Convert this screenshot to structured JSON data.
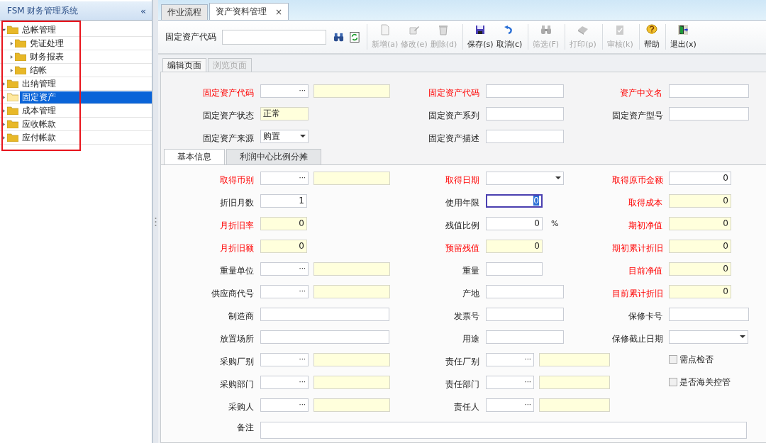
{
  "app": {
    "title": "FSM 财务管理系统",
    "collapse_glyph": "«"
  },
  "tree": [
    {
      "label": "总帐管理",
      "selected": false,
      "expanded": true,
      "children": [
        {
          "label": "凭证处理",
          "selected": false,
          "expanded": false
        },
        {
          "label": "财务报表",
          "selected": false,
          "expanded": false
        },
        {
          "label": "结帐",
          "selected": false,
          "expanded": false
        }
      ]
    },
    {
      "label": "出纳管理",
      "selected": false,
      "expanded": false
    },
    {
      "label": "固定资产",
      "selected": true,
      "expanded": false
    },
    {
      "label": "成本管理",
      "selected": false,
      "expanded": false
    },
    {
      "label": "应收帐款",
      "selected": false,
      "expanded": false
    },
    {
      "label": "应付帐款",
      "selected": false,
      "expanded": false
    }
  ],
  "tabs": [
    {
      "label": "作业流程",
      "selected": false
    },
    {
      "label": "资产资料管理",
      "selected": true,
      "close": "×"
    }
  ],
  "toolbar": {
    "search_label": "固定资产代码",
    "groups": [
      [
        {
          "label": "新增(a)",
          "kind": "new",
          "disabled": true
        },
        {
          "label": "修改(e)",
          "kind": "edit",
          "disabled": true
        },
        {
          "label": "删除(d)",
          "kind": "delete",
          "disabled": true
        }
      ],
      [
        {
          "label": "保存(s)",
          "kind": "save",
          "disabled": false
        },
        {
          "label": "取消(c)",
          "kind": "undo",
          "disabled": false
        }
      ],
      [
        {
          "label": "筛选(F)",
          "kind": "filter",
          "disabled": true
        }
      ],
      [
        {
          "label": "打印(p)",
          "kind": "print",
          "disabled": true
        }
      ],
      [
        {
          "label": "审核(k)",
          "kind": "audit",
          "disabled": true
        }
      ],
      [
        {
          "label": "帮助",
          "kind": "help",
          "disabled": false
        }
      ],
      [
        {
          "label": "退出(x)",
          "kind": "exit",
          "disabled": false
        }
      ]
    ]
  },
  "page_tabs": [
    {
      "label": "编辑页面",
      "selected": true
    },
    {
      "label": "浏览页面",
      "selected": false
    }
  ],
  "header_form": {
    "rows": [
      [
        {
          "label": "固定资产代码",
          "required": true,
          "kind": "lookup",
          "readonly": false,
          "button": "···"
        },
        {
          "label": "固定资产代码",
          "required": true,
          "kind": "text",
          "readonly": false
        },
        {
          "label": "资产中文名",
          "required": true,
          "kind": "text",
          "readonly": false
        }
      ],
      [
        {
          "label": "固定资产状态",
          "required": false,
          "kind": "short-text",
          "readonly": true,
          "value": "正常"
        },
        {
          "label": "固定资产系列",
          "required": false,
          "kind": "text",
          "readonly": false
        },
        {
          "label": "固定资产型号",
          "required": false,
          "kind": "text",
          "readonly": false
        }
      ],
      [
        {
          "label": "固定资产来源",
          "required": false,
          "kind": "select",
          "readonly": false,
          "value": "购置"
        },
        {
          "label": "固定资产描述",
          "required": false,
          "kind": "text",
          "readonly": false
        }
      ]
    ]
  },
  "detail_tabs": [
    {
      "label": "基本信息",
      "selected": true
    },
    {
      "label": "利润中心比例分摊",
      "selected": false
    }
  ],
  "detail_form": {
    "rows": [
      [
        {
          "label": "取得币别",
          "required": true,
          "kind": "lookup",
          "readonly": false,
          "button": "···"
        },
        {
          "label": "取得日期",
          "required": true,
          "kind": "select",
          "readonly": false
        },
        {
          "label": "取得原币金额",
          "required": true,
          "kind": "number",
          "readonly": false,
          "value": "0"
        }
      ],
      [
        {
          "label": "折旧月数",
          "required": false,
          "kind": "number",
          "readonly": false,
          "value": "1"
        },
        {
          "label": "使用年限",
          "required": false,
          "kind": "number",
          "readonly": false,
          "value": "0",
          "focused": true
        },
        {
          "label": "取得成本",
          "required": true,
          "kind": "number",
          "readonly": true,
          "value": "0"
        }
      ],
      [
        {
          "label": "月折旧率",
          "required": true,
          "kind": "number",
          "readonly": true,
          "value": "0"
        },
        {
          "label": "残值比例",
          "required": false,
          "kind": "number",
          "readonly": false,
          "value": "0",
          "suffix": "%"
        },
        {
          "label": "期初净值",
          "required": true,
          "kind": "number",
          "readonly": true,
          "value": "0"
        }
      ],
      [
        {
          "label": "月折旧额",
          "required": true,
          "kind": "number",
          "readonly": true,
          "value": "0"
        },
        {
          "label": "预留残值",
          "required": true,
          "kind": "number",
          "readonly": true,
          "value": "0"
        },
        {
          "label": "期初累计折旧",
          "required": true,
          "kind": "number",
          "readonly": true,
          "value": "0"
        }
      ],
      [
        {
          "label": "重量单位",
          "required": false,
          "kind": "lookup",
          "readonly": false,
          "button": "···"
        },
        {
          "label": "重量",
          "required": false,
          "kind": "short-text",
          "readonly": false
        },
        {
          "label": "目前净值",
          "required": true,
          "kind": "number",
          "readonly": true,
          "value": "0"
        }
      ],
      [
        {
          "label": "供应商代号",
          "required": false,
          "kind": "lookup",
          "readonly": false,
          "button": "···"
        },
        {
          "label": "产地",
          "required": false,
          "kind": "text",
          "readonly": false
        },
        {
          "label": "目前累计折旧",
          "required": true,
          "kind": "number",
          "readonly": true,
          "value": "0"
        }
      ],
      [
        {
          "label": "制造商",
          "required": false,
          "kind": "wide-text",
          "readonly": false
        },
        {
          "label": "发票号",
          "required": false,
          "kind": "text",
          "readonly": false
        },
        {
          "label": "保修卡号",
          "required": false,
          "kind": "text",
          "readonly": false
        }
      ],
      [
        {
          "label": "放置场所",
          "required": false,
          "kind": "wide-text",
          "readonly": false
        },
        {
          "label": "用途",
          "required": false,
          "kind": "text",
          "readonly": false
        },
        {
          "label": "保修截止日期",
          "required": false,
          "kind": "select",
          "readonly": false
        }
      ],
      [
        {
          "label": "采购厂别",
          "required": false,
          "kind": "lookup",
          "readonly": false,
          "button": "···"
        },
        {
          "label": "责任厂别",
          "required": false,
          "kind": "lookup",
          "readonly": false,
          "button": "···"
        },
        {
          "label": "需点检否",
          "kind": "checkbox",
          "checked": false
        }
      ],
      [
        {
          "label": "采购部门",
          "required": false,
          "kind": "lookup",
          "readonly": false,
          "button": "···"
        },
        {
          "label": "责任部门",
          "required": false,
          "kind": "lookup",
          "readonly": false,
          "button": "···"
        },
        {
          "label": "是否海关控管",
          "kind": "checkbox",
          "checked": false
        }
      ],
      [
        {
          "label": "采购人",
          "required": false,
          "kind": "lookup",
          "readonly": false,
          "button": "···"
        },
        {
          "label": "责任人",
          "required": false,
          "kind": "lookup",
          "readonly": false,
          "button": "···"
        }
      ]
    ],
    "remark": {
      "label": "备注"
    }
  }
}
